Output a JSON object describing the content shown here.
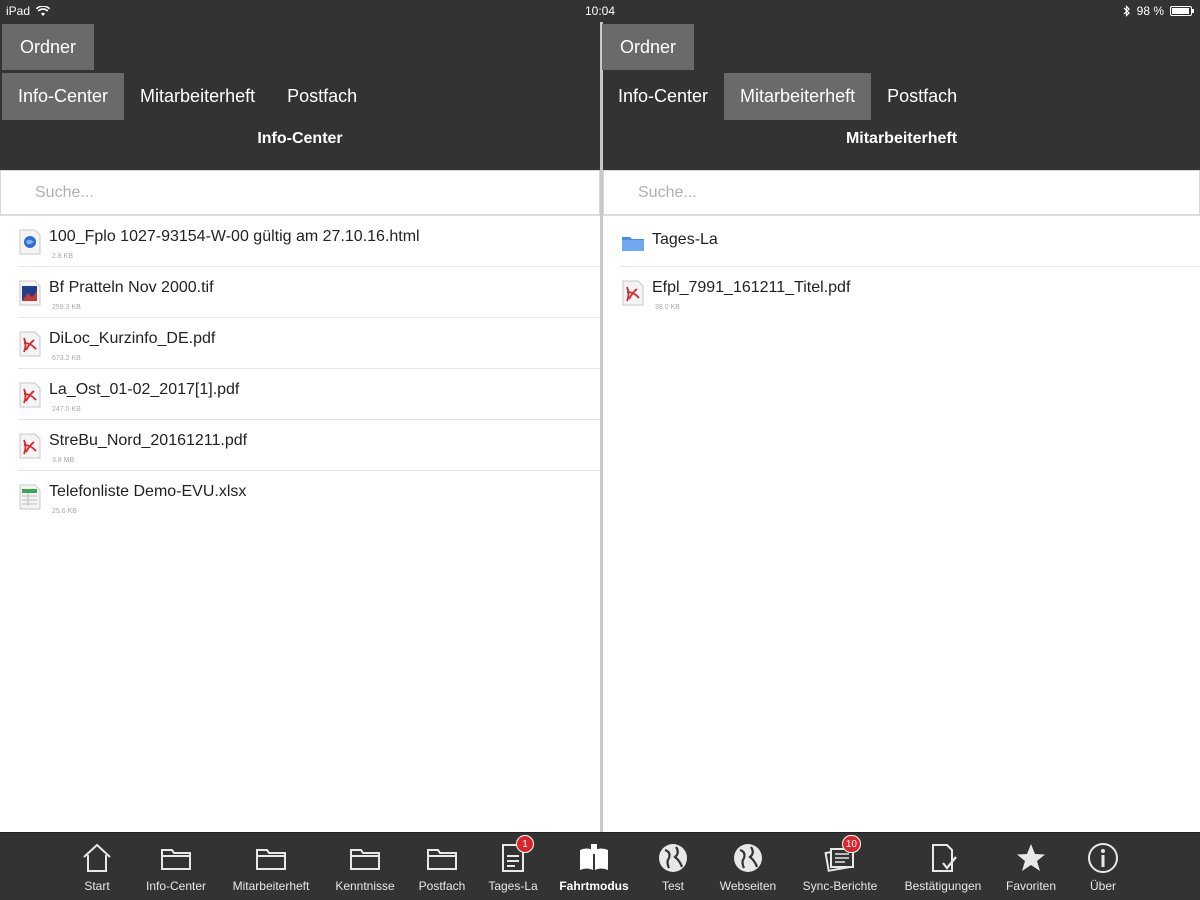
{
  "status_bar": {
    "device": "iPad",
    "time": "10:04",
    "battery": "98 %",
    "icons": [
      "wifi-icon",
      "bluetooth-icon",
      "battery-icon"
    ]
  },
  "left_pane": {
    "folder_button": "Ordner",
    "tabs": [
      {
        "label": "Info-Center",
        "active": true
      },
      {
        "label": "Mitarbeiterheft",
        "active": false
      },
      {
        "label": "Postfach",
        "active": false
      }
    ],
    "title": "Info-Center",
    "search_placeholder": "Suche...",
    "files": [
      {
        "name": "100_Fplo 1027-93154-W-00 gültig am 27.10.16.html",
        "size": "2.8 KB",
        "icon": "html-file-icon"
      },
      {
        "name": "Bf Pratteln Nov 2000.tif",
        "size": "259.3 KB",
        "icon": "image-file-icon"
      },
      {
        "name": "DiLoc_Kurzinfo_DE.pdf",
        "size": "673.2 KB",
        "icon": "pdf-file-icon"
      },
      {
        "name": "La_Ost_01-02_2017[1].pdf",
        "size": "247.0 KB",
        "icon": "pdf-file-icon"
      },
      {
        "name": "StreBu_Nord_20161211.pdf",
        "size": "3.8 MB",
        "icon": "pdf-file-icon"
      },
      {
        "name": "Telefonliste Demo-EVU.xlsx",
        "size": "25.6 KB",
        "icon": "spreadsheet-file-icon"
      }
    ]
  },
  "right_pane": {
    "folder_button": "Ordner",
    "tabs": [
      {
        "label": "Info-Center",
        "active": false
      },
      {
        "label": "Mitarbeiterheft",
        "active": true
      },
      {
        "label": "Postfach",
        "active": false
      }
    ],
    "title": "Mitarbeiterheft",
    "search_placeholder": "Suche...",
    "folders": [
      {
        "name": "Tages-La",
        "icon": "folder-icon"
      }
    ],
    "files": [
      {
        "name": "Efpl_7991_161211_Titel.pdf",
        "size": "38.0 KB",
        "icon": "pdf-file-icon"
      }
    ]
  },
  "tab_bar": {
    "items": [
      {
        "label": "Start",
        "icon": "home-icon",
        "badge": ""
      },
      {
        "label": "Info-Center",
        "icon": "folder-icon",
        "badge": ""
      },
      {
        "label": "Mitarbeiterheft",
        "icon": "folder-icon",
        "badge": ""
      },
      {
        "label": "Kenntnisse",
        "icon": "folder-icon",
        "badge": ""
      },
      {
        "label": "Postfach",
        "icon": "folder-icon",
        "badge": ""
      },
      {
        "label": "Tages-La",
        "icon": "document-icon",
        "badge": "1"
      },
      {
        "label": "Fahrtmodus",
        "icon": "book-icon",
        "badge": "",
        "active": true
      },
      {
        "label": "Test",
        "icon": "globe-icon",
        "badge": ""
      },
      {
        "label": "Webseiten",
        "icon": "globe-icon",
        "badge": ""
      },
      {
        "label": "Sync-Berichte",
        "icon": "reports-icon",
        "badge": "10"
      },
      {
        "label": "Bestätigungen",
        "icon": "confirm-document-icon",
        "badge": ""
      },
      {
        "label": "Favoriten",
        "icon": "star-icon",
        "badge": ""
      },
      {
        "label": "Über",
        "icon": "info-icon",
        "badge": ""
      }
    ]
  }
}
